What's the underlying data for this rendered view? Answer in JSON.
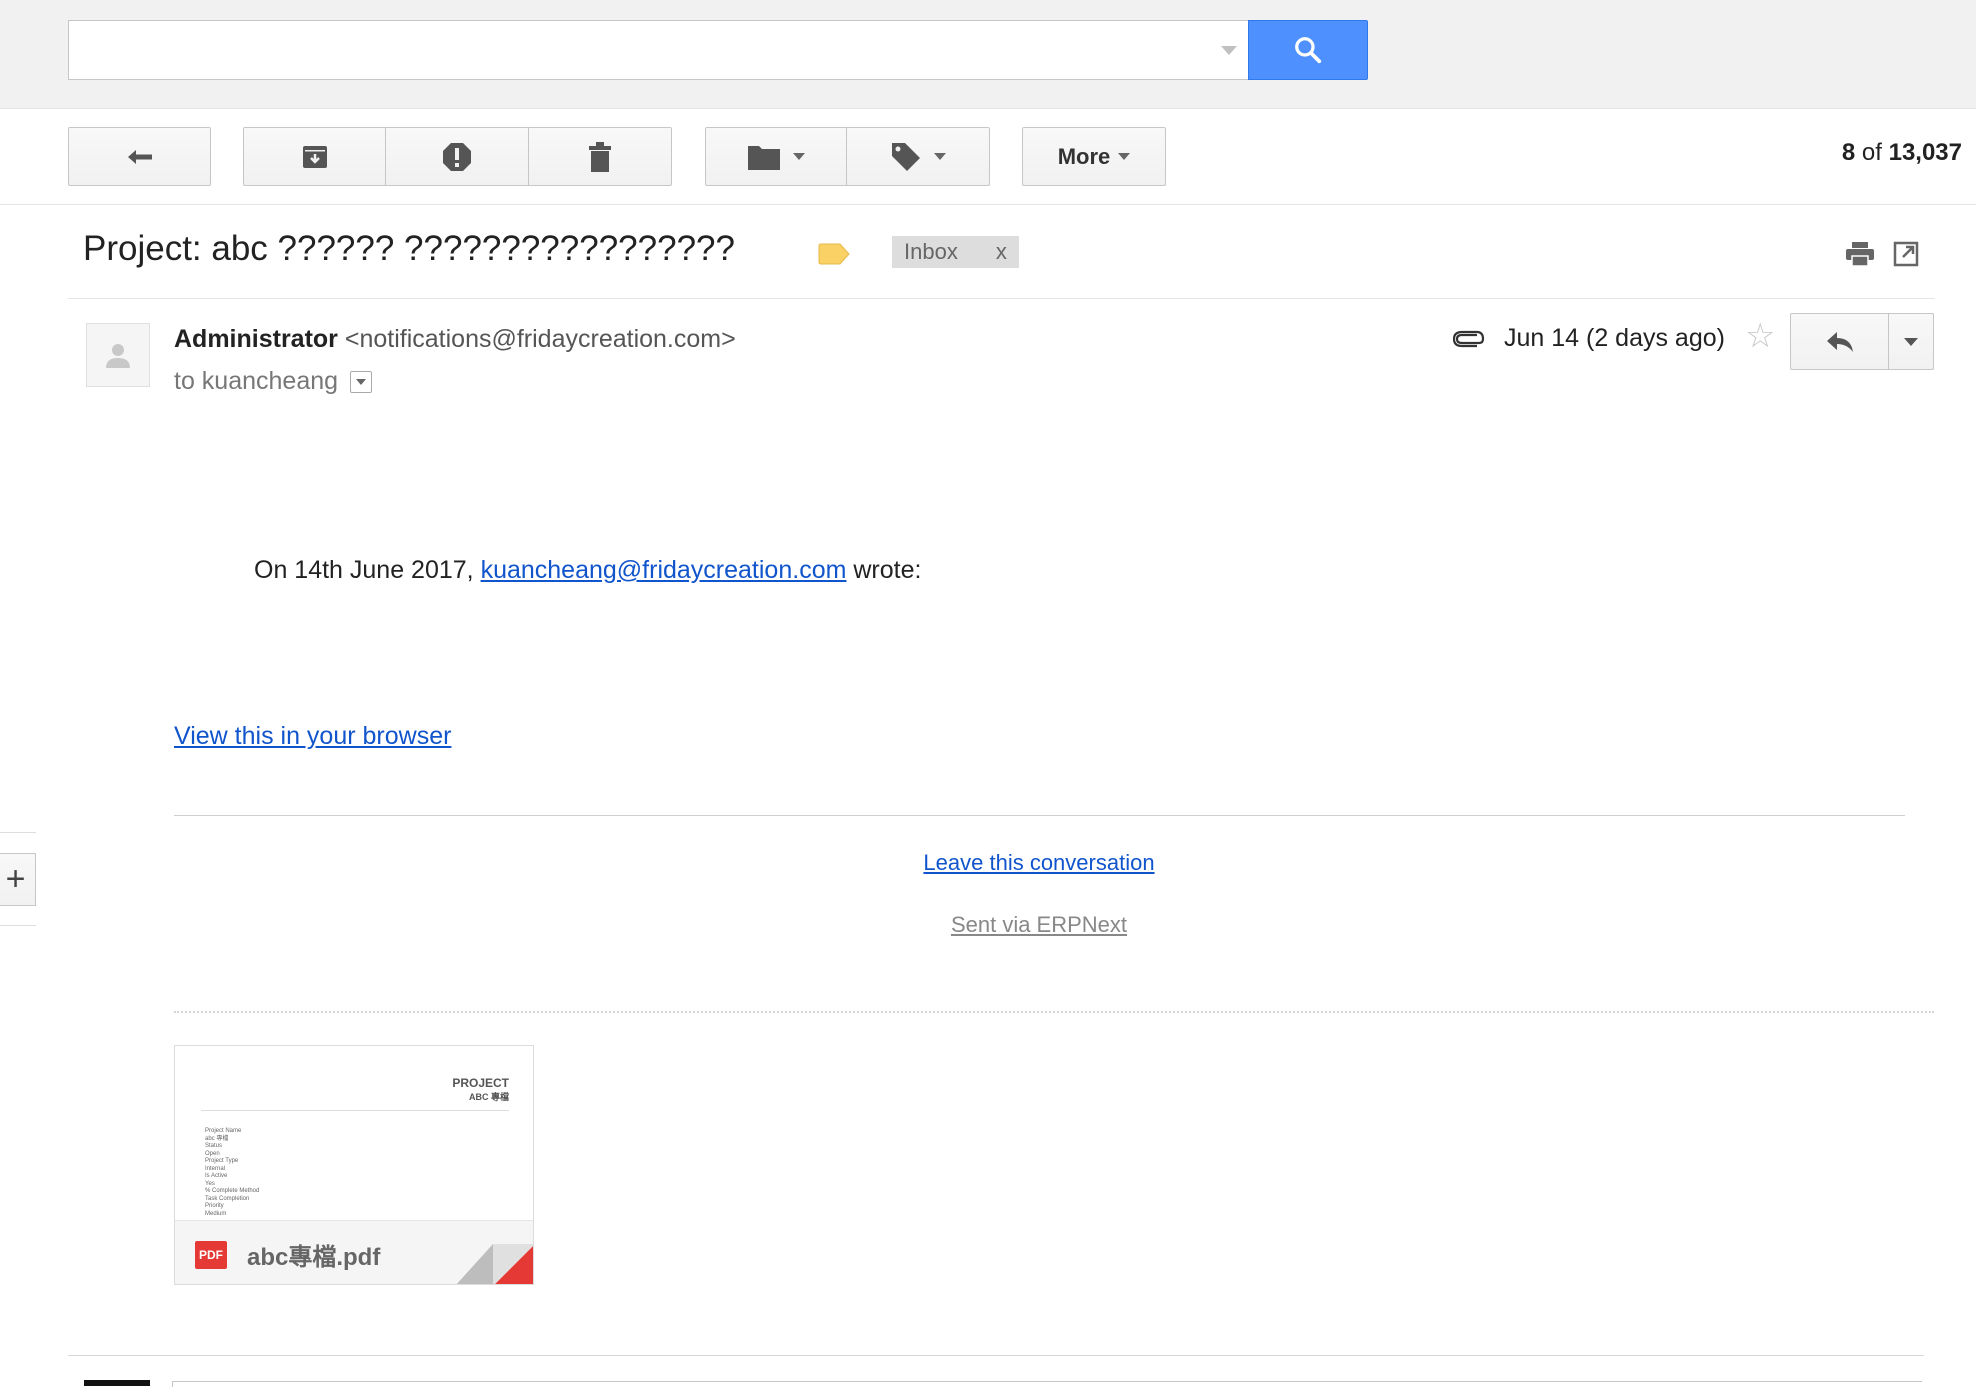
{
  "search": {
    "value": "",
    "placeholder": ""
  },
  "toolbar": {
    "more_label": "More",
    "counter": {
      "current": "8",
      "of": "of",
      "total": "13,037"
    }
  },
  "thread": {
    "subject": "Project: abc ?????? ?????????????????",
    "labels": [
      {
        "name": "Inbox",
        "remove": "x"
      }
    ]
  },
  "message": {
    "sender_name": "Administrator",
    "sender_email": "<notifications@fridaycreation.com>",
    "to_line": "to kuancheang",
    "date": "Jun 14 (2 days ago)",
    "body": {
      "quote_prefix": "On 14th June 2017, ",
      "quote_email": "kuancheang@fridaycreation.com",
      "quote_suffix": " wrote:",
      "view_browser": "View this in your browser",
      "leave_conversation": "Leave this conversation",
      "sent_via": "Sent via ERPNext"
    },
    "attachment": {
      "filename": "abc專檔.pdf",
      "type_badge": "PDF",
      "thumb_title_1": "PROJECT",
      "thumb_title_2": "ABC 專檔",
      "thumb_lines": [
        "Project Name",
        "abc 專檔",
        "Status",
        "Open",
        "Project Type",
        "Internal",
        "Is Active",
        "Yes",
        "% Complete Method",
        "Task Completion",
        "Priority",
        "Medium"
      ]
    }
  },
  "colors": {
    "search_blue": "#4d90fe",
    "link_blue": "#1155cc",
    "label_yellow": "#fad165",
    "pdf_red": "#e53935"
  }
}
